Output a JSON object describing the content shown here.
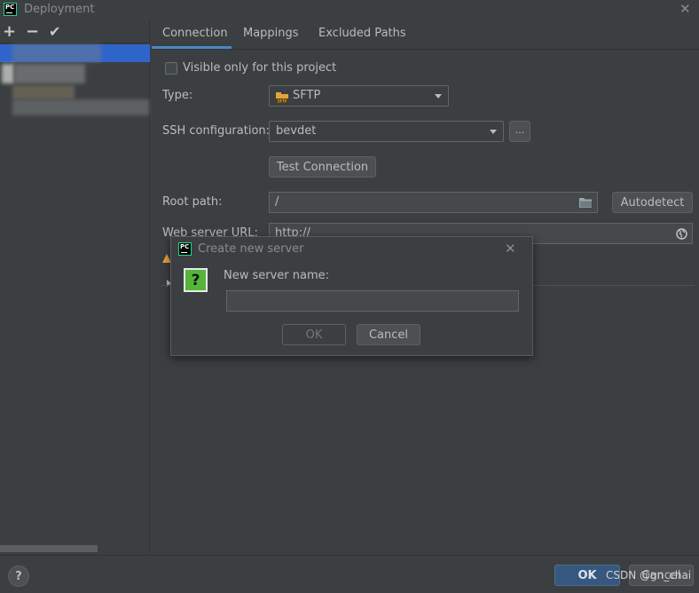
{
  "window": {
    "title": "Deployment"
  },
  "left_toolbar": {
    "add": "+",
    "remove": "−",
    "apply": "✔"
  },
  "tabs": [
    {
      "label": "Connection",
      "active": true
    },
    {
      "label": "Mappings"
    },
    {
      "label": "Excluded Paths"
    }
  ],
  "form": {
    "visible_only_label": "Visible only for this project",
    "visible_only_checked": false,
    "type_label": "Type:",
    "type_value": "SFTP",
    "type_icon_text": "SFTP",
    "ssh_label": "SSH configuration:",
    "ssh_value": "bevdet",
    "ssh_browse": "...",
    "test_connection": "Test Connection",
    "root_path_label": "Root path:",
    "root_path_value": "/",
    "autodetect": "Autodetect",
    "web_url_label": "Web server URL:",
    "web_url_value": "http://"
  },
  "dialog": {
    "title": "Create new server",
    "question_icon": "?",
    "prompt": "New server name:",
    "input_value": "",
    "ok": "OK",
    "cancel": "Cancel"
  },
  "footer": {
    "help": "?",
    "ok": "OK",
    "cancel": "Cancel",
    "watermark": "CSDN @gn_chai"
  },
  "colors": {
    "accent": "#4a88c7",
    "selection": "#2f65ca",
    "ok_button": "#365880",
    "background": "#3c3f41"
  }
}
